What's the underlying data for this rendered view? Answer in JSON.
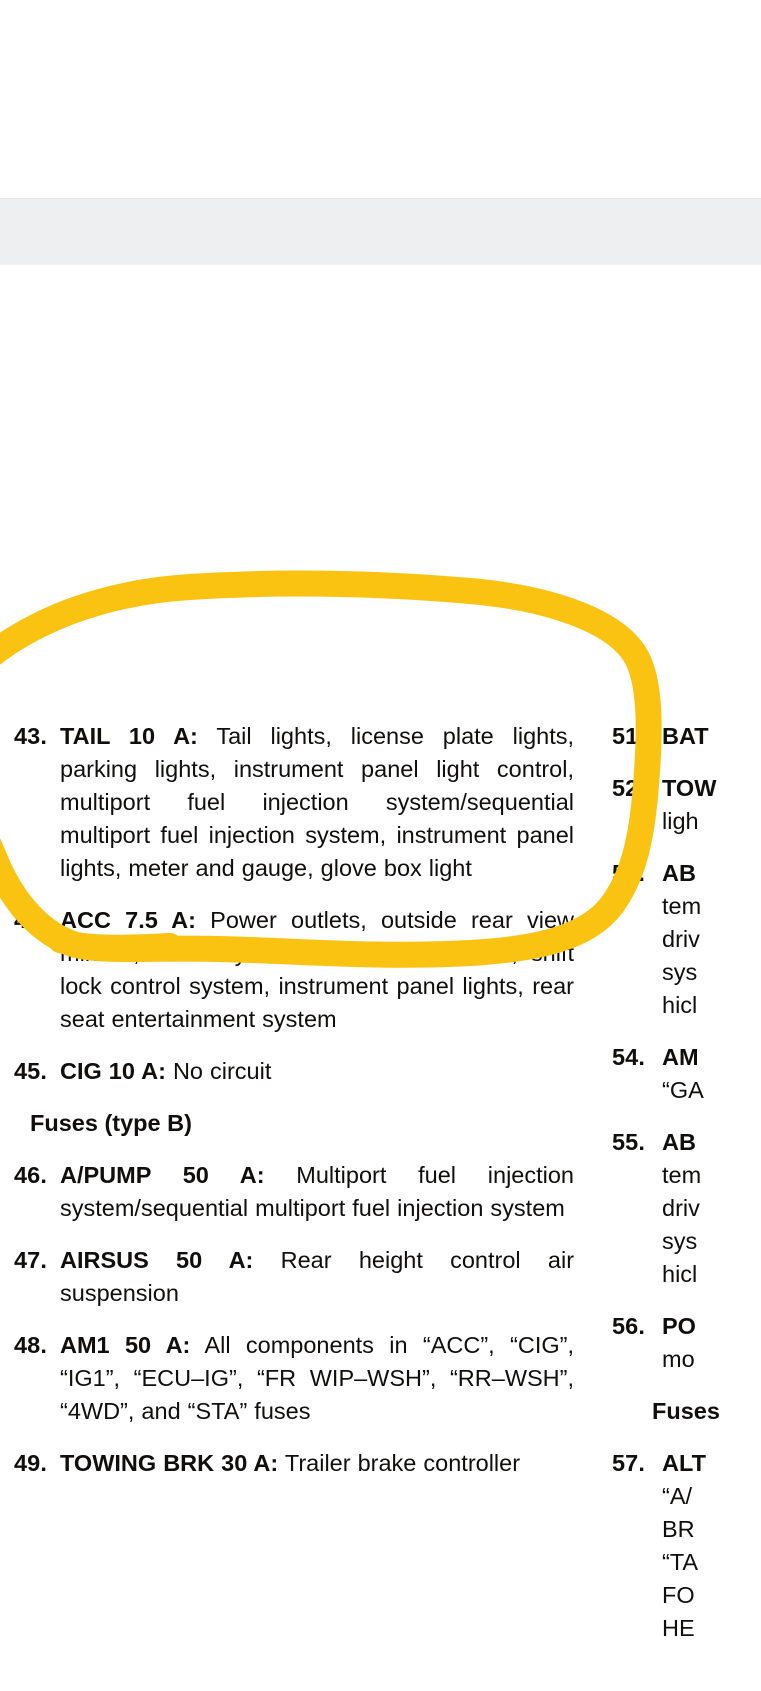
{
  "document": {
    "type": "vehicle owner manual fuse list page",
    "left_column": {
      "items": [
        {
          "number": "43.",
          "label": "TAIL 10 A:",
          "text": "Tail lights, license plate lights, parking lights, instrument panel light control, multiport fuel injection system/sequential multiport fuel injection system, instrument panel lights, meter and gauge, glove box light"
        },
        {
          "number": "44.",
          "label": "ACC 7.5 A:",
          "text": "Power outlets, outside rear view mirrors, audio system, navigation system, shift lock control system, instrument panel lights, rear seat entertainment system"
        },
        {
          "number": "45.",
          "label": "CIG 10 A:",
          "text": "No circuit"
        }
      ],
      "subheading": "Fuses (type B)",
      "items_after_subheading": [
        {
          "number": "46.",
          "label": "A/PUMP 50 A:",
          "text": "Multiport fuel injection system/sequential multiport fuel injection system"
        },
        {
          "number": "47.",
          "label": "AIRSUS 50 A:",
          "text": "Rear height control air suspension"
        },
        {
          "number": "48.",
          "label": "AM1 50 A:",
          "text": "All components in “ACC”, “CIG”, “IG1”, “ECU–IG”, “FR WIP–WSH”, “RR–WSH”, “4WD”, and “STA” fuses"
        },
        {
          "number": "49.",
          "label": "TOWING BRK 30 A:",
          "text": "Trailer brake controller"
        }
      ]
    },
    "right_column": {
      "items": [
        {
          "number": "51.",
          "label": "BAT",
          "text": ""
        },
        {
          "number": "52.",
          "label": "TOW",
          "text": "ligh"
        },
        {
          "number": "53.",
          "label": "AB",
          "text": "tem\ndriv\nsys\nhicl"
        },
        {
          "number": "54.",
          "label": "AM",
          "text": "“GA"
        },
        {
          "number": "55.",
          "label": "AB",
          "text": "tem\ndriv\nsys\nhicl"
        },
        {
          "number": "56.",
          "label": "PO",
          "text": "mo"
        }
      ],
      "subheading": "Fuses",
      "items_after_subheading": [
        {
          "number": "57.",
          "label": "ALT",
          "text": "“A/\nBR\n“TA\nFO\nHE"
        }
      ]
    }
  },
  "annotation": {
    "type": "hand-drawn-circle",
    "color": "#fbc311",
    "encircles": "item 43 TAIL 10 A entry"
  },
  "colors": {
    "background": "#ffffff",
    "gray_band": "#eeeff1",
    "text": "#100f0d",
    "highlight": "#fbc311"
  }
}
